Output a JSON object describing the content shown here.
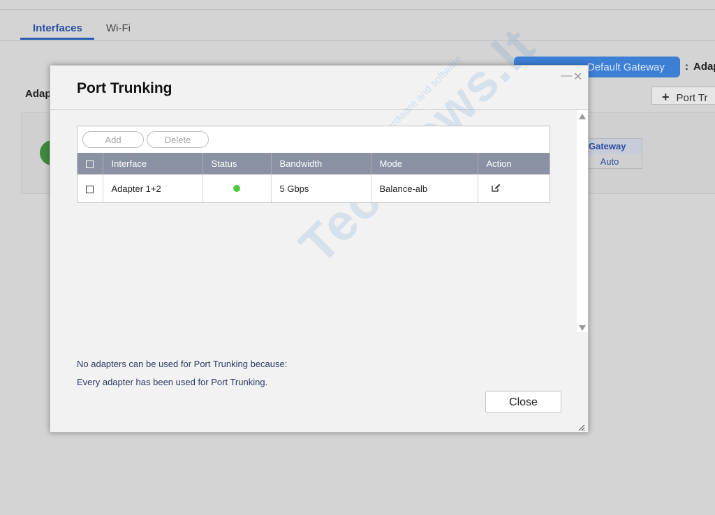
{
  "tabs": [
    {
      "label": "Interfaces",
      "active": true
    },
    {
      "label": "Wi-Fi",
      "active": false
    }
  ],
  "header": {
    "gateway_button": "Default Gateway",
    "gateway_colon": ":",
    "gateway_value": "Adap",
    "port_button": "Port Tr",
    "adapters_label": "Adap"
  },
  "background_table": {
    "header": "Gateway",
    "value": "Auto"
  },
  "modal": {
    "title": "Port Trunking",
    "minimize": "—",
    "close_x": "✕",
    "toolbar": {
      "add": "Add",
      "delete": "Delete"
    },
    "columns": [
      "Interface",
      "Status",
      "Bandwidth",
      "Mode",
      "Action"
    ],
    "rows": [
      {
        "interface": "Adapter 1+2",
        "status": "online",
        "bandwidth": "5 Gbps",
        "mode": "Balance-alb"
      }
    ],
    "message_line1": "No adapters can be used for Port Trunking because:",
    "message_line2": "Every adapter has been used for Port Trunking.",
    "close_button": "Close"
  },
  "watermark": {
    "brand": "Technews.lt",
    "tagline": "Where geeks meet hardware and software"
  },
  "colors": {
    "accent": "#3e7fd6",
    "tab_active": "#2a4fa0",
    "table_header": "#8a91a3",
    "status_ok": "#4cc93c",
    "message_text": "#2b3a63"
  }
}
